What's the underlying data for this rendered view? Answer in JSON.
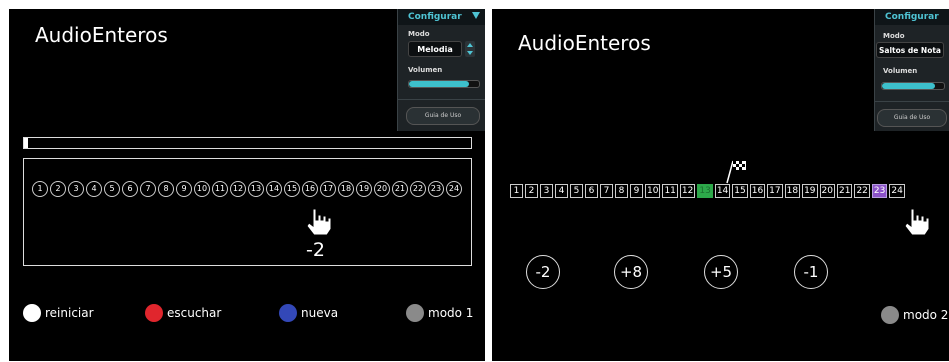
{
  "left": {
    "title": "AudioEnteros",
    "config": {
      "header": "Configurar",
      "mode_label": "Modo",
      "mode_value": "Melodia",
      "volume_label": "Volumen",
      "volume_level": 0.85,
      "guide_button": "Guia de Uso"
    },
    "progress": 0.01,
    "numbers": [
      "1",
      "2",
      "3",
      "4",
      "5",
      "6",
      "7",
      "8",
      "9",
      "10",
      "11",
      "12",
      "13",
      "14",
      "15",
      "16",
      "17",
      "18",
      "19",
      "20",
      "21",
      "22",
      "23",
      "24"
    ],
    "offset": "-2",
    "controls": [
      {
        "label": "reiniciar",
        "color": "#ffffff"
      },
      {
        "label": "escuchar",
        "color": "#e0262d"
      },
      {
        "label": "nueva",
        "color": "#3348b8"
      },
      {
        "label": "modo 1",
        "color": "#8a8a8a"
      }
    ]
  },
  "right": {
    "title": "AudioEnteros",
    "config": {
      "header": "Configurar",
      "mode_label": "Modo",
      "mode_value": "Saltos de Nota",
      "volume_label": "Volumen",
      "volume_level": 0.85,
      "guide_button": "Guia de Uso"
    },
    "numbers": [
      "1",
      "2",
      "3",
      "4",
      "5",
      "6",
      "7",
      "8",
      "9",
      "10",
      "11",
      "12",
      "13",
      "14",
      "15",
      "16",
      "17",
      "18",
      "19",
      "20",
      "21",
      "22",
      "23",
      "24"
    ],
    "highlight_start": "13",
    "highlight_target": "23",
    "colors": {
      "start": "#2da84a",
      "target": "#8b52c8"
    },
    "options": [
      "-2",
      "+8",
      "+5",
      "-1"
    ],
    "mode_button": {
      "label": "modo 2",
      "color": "#8a8a8a"
    }
  }
}
